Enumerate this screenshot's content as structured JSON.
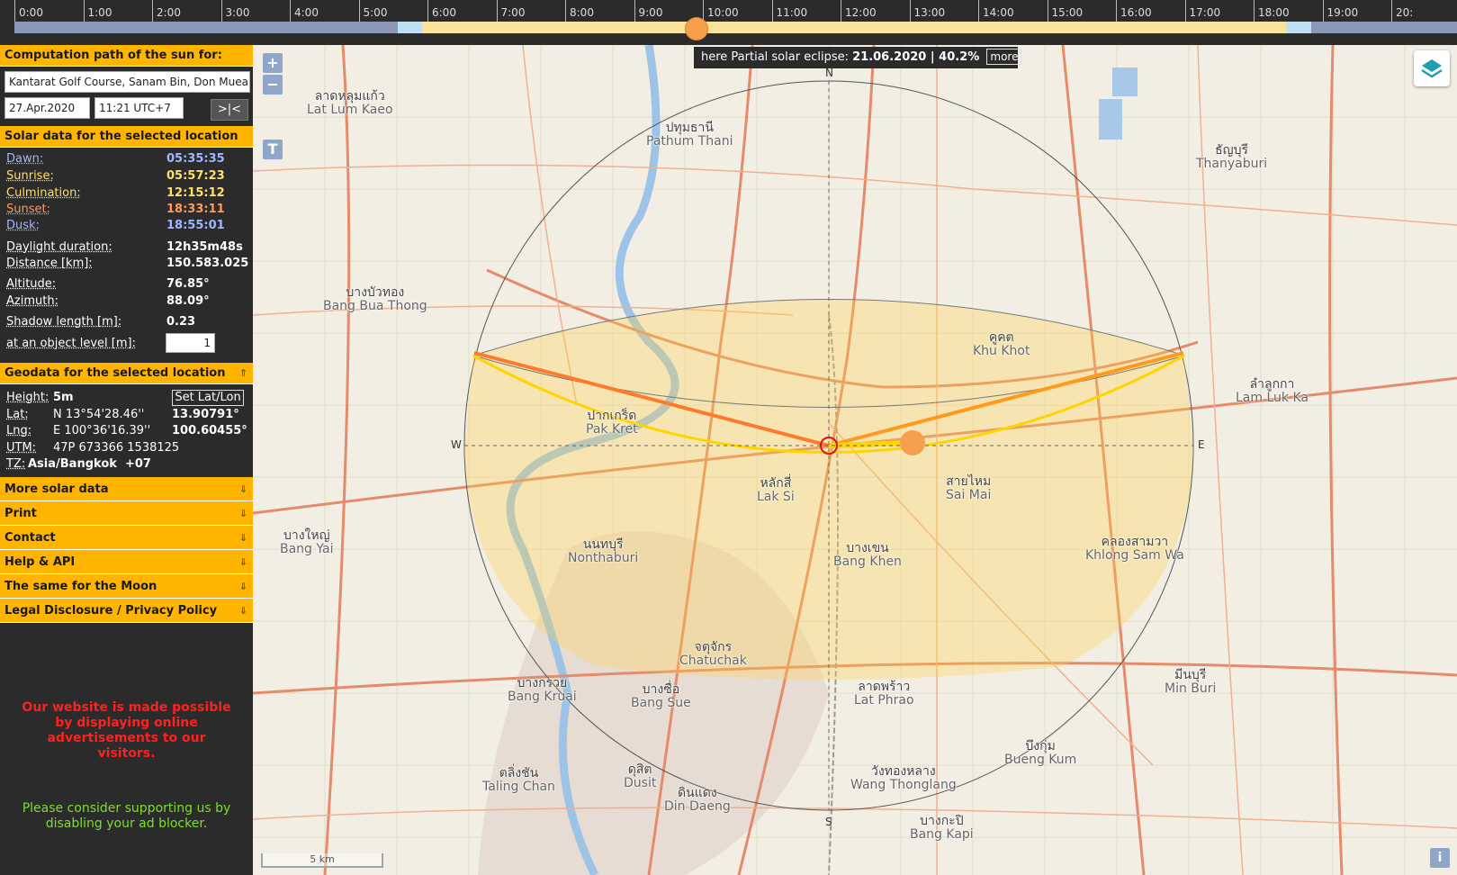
{
  "timeline": {
    "hours": [
      "0:00",
      "1:00",
      "2:00",
      "3:00",
      "4:00",
      "5:00",
      "6:00",
      "7:00",
      "8:00",
      "9:00",
      "10:00",
      "11:00",
      "12:00",
      "13:00",
      "14:00",
      "15:00",
      "16:00",
      "17:00",
      "18:00",
      "19:00",
      "20:"
    ],
    "current_time_fraction": 0.473
  },
  "sidebar": {
    "computation_header": "Computation path of the sun for:",
    "location_value": "Kantarat Golf Course, Sanam Bin, Don Mueang",
    "date_value": "27.Apr.2020",
    "time_value": "11:21 UTC+7",
    "now_button": ">|<",
    "solar_header": "Solar data for the selected location",
    "solar": {
      "dawn_label": "Dawn:",
      "dawn_value": "05:35:35",
      "sunrise_label": "Sunrise:",
      "sunrise_value": "05:57:23",
      "culmination_label": "Culmination:",
      "culmination_value": "12:15:12",
      "sunset_label": "Sunset:",
      "sunset_value": "18:33:11",
      "dusk_label": "Dusk:",
      "dusk_value": "18:55:01",
      "daylight_label": "Daylight duration:",
      "daylight_value": "12h35m48s",
      "distance_label": "Distance [km]:",
      "distance_value": "150.583.025",
      "altitude_label": "Altitude:",
      "altitude_value": "76.85°",
      "azimuth_label": "Azimuth:",
      "azimuth_value": "88.09°",
      "shadow_label": "Shadow length [m]:",
      "shadow_value": "0.23",
      "object_level_label": "at an object level [m]:",
      "object_level_value": "1"
    },
    "geo_header": "Geodata for the selected location",
    "geo": {
      "height_label": "Height:",
      "height_value": "5m",
      "set_latlon_button": "Set Lat/Lon",
      "lat_label": "Lat:",
      "lat_dms": "N 13°54'28.46''",
      "lat_dec": "13.90791°",
      "lng_label": "Lng:",
      "lng_dms": "E 100°36'16.39''",
      "lng_dec": "100.60455°",
      "utm_label": "UTM:",
      "utm_value": "47P 673366 1538125",
      "tz_label": "TZ:",
      "tz_value": "Asia/Bangkok  +07"
    },
    "accordions": [
      "More solar data",
      "Print",
      "Contact",
      "Help & API",
      "The same for the Moon",
      "Legal Disclosure / Privacy Policy"
    ],
    "ad_notice": "Our website is made possible by displaying online advertisements to our visitors.",
    "ad_request": "Please consider supporting us by disabling your ad blocker.",
    "colors": {
      "accent": "#ffb400",
      "dawn": "#9fb7ff",
      "sunrise": "#ffe066",
      "culmination": "#ffe066",
      "sunset": "#ff9a5a",
      "dusk": "#9fb7ff",
      "ad_notice": "#ff2020",
      "ad_request": "#7ddf2a"
    }
  },
  "map": {
    "eclipse_prefix": "here Partial solar eclipse:",
    "eclipse_value": "21.06.2020 | 40.2%",
    "more_button": "more",
    "zoom_in": "+",
    "zoom_out": "−",
    "text_button": "T",
    "info_button": "i",
    "scale_label": "5 km",
    "compass": {
      "n": "N",
      "s": "S",
      "e": "E",
      "w": "W"
    },
    "places": [
      {
        "th": "ปทุมธานี",
        "en": "Pathum Thani"
      },
      {
        "th": "ธัญบุรี",
        "en": "Thanyaburi"
      },
      {
        "th": "บางบัวทอง",
        "en": "Bang Bua Thong"
      },
      {
        "th": "คูคต",
        "en": "Khu Khot"
      },
      {
        "th": "ลำลูกกา",
        "en": "Lam Luk Ka"
      },
      {
        "th": "ปากเกร็ด",
        "en": "Pak Kret"
      },
      {
        "th": "หลักสี่",
        "en": "Lak Si"
      },
      {
        "th": "สายไหม",
        "en": "Sai Mai"
      },
      {
        "th": "บางใหญ่",
        "en": "Bang Yai"
      },
      {
        "th": "นนทบุรี",
        "en": "Nonthaburi"
      },
      {
        "th": "บางเขน",
        "en": "Bang Khen"
      },
      {
        "th": "คลองสามวา",
        "en": "Khlong Sam Wa"
      },
      {
        "th": "จตุจักร",
        "en": "Chatuchak"
      },
      {
        "th": "บางกรวย",
        "en": "Bang Kruai"
      },
      {
        "th": "บางซื่อ",
        "en": "Bang Sue"
      },
      {
        "th": "ลาดพร้าว",
        "en": "Lat Phrao"
      },
      {
        "th": "มีนบุรี",
        "en": "Min Buri"
      },
      {
        "th": "บึงกุ่ม",
        "en": "Bueng Kum"
      },
      {
        "th": "ตลิ่งชัน",
        "en": "Taling Chan"
      },
      {
        "th": "ดุสิต",
        "en": "Dusit"
      },
      {
        "th": "ดินแดง",
        "en": "Din Daeng"
      },
      {
        "th": "วังทองหลาง",
        "en": "Wang Thonglang"
      },
      {
        "th": "บางกะปิ",
        "en": "Bang Kapi"
      },
      {
        "th": "ลาดหลุมแก้ว",
        "en": "Lat Lum Kaeo"
      }
    ]
  }
}
